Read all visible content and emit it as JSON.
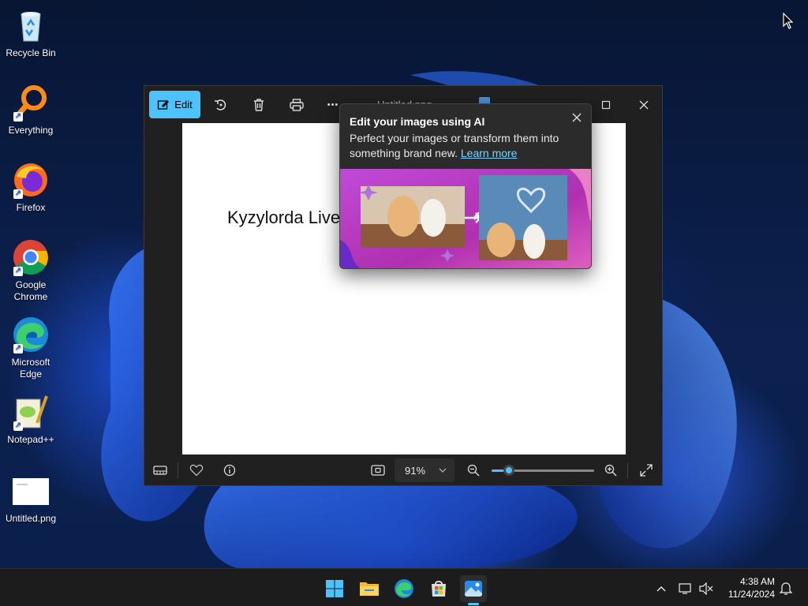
{
  "desktop": {
    "icons": [
      {
        "label": "Recycle Bin"
      },
      {
        "label": "Everything"
      },
      {
        "label": "Firefox"
      },
      {
        "label": "Google Chrome"
      },
      {
        "label": "Microsoft Edge"
      },
      {
        "label": "Notepad++"
      },
      {
        "label": "Untitled.png"
      }
    ]
  },
  "photos": {
    "title": "Untitled.png",
    "edit_label": "Edit",
    "more_label": "•••",
    "canvas_text": "Kyzylorda Live",
    "zoom_value": "91%",
    "zoom_level": 0.17
  },
  "ai_popup": {
    "title": "Edit your images using AI",
    "description": "Perfect your images or transform them into something brand new.",
    "link": "Learn more"
  },
  "taskbar": {
    "time": "4:38 AM",
    "date": "11/24/2024"
  },
  "colors": {
    "accent": "#4cc2ff",
    "window_bg": "#202020",
    "taskbar_bg": "#1c1c1c"
  }
}
